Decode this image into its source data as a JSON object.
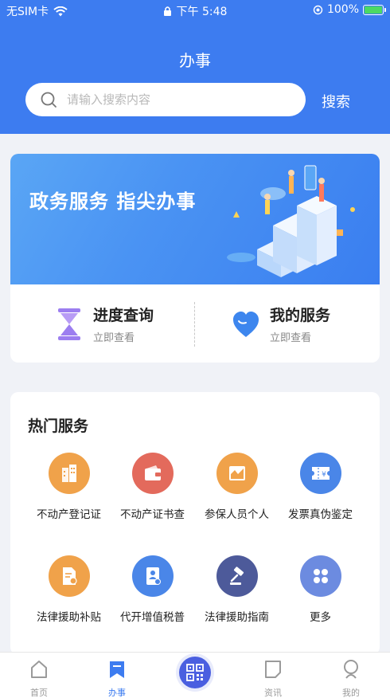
{
  "status_bar": {
    "carrier": "无SIM卡",
    "time": "下午 5:48",
    "battery": "100%"
  },
  "header": {
    "title": "办事",
    "search_placeholder": "请输入搜索内容",
    "search_button": "搜索"
  },
  "banner": {
    "text": "政务服务  指尖办事"
  },
  "quick": [
    {
      "title": "进度查询",
      "subtitle": "立即查看"
    },
    {
      "title": "我的服务",
      "subtitle": "立即查看"
    }
  ],
  "hot_services": {
    "title": "热门服务",
    "items": [
      {
        "label": "不动产登记证",
        "icon": "building-icon",
        "color": "#f0a24a"
      },
      {
        "label": "不动产证书查",
        "icon": "wallet-icon",
        "color": "#e36a5c"
      },
      {
        "label": "参保人员个人",
        "icon": "chart-icon",
        "color": "#f0a24a"
      },
      {
        "label": "发票真伪鉴定",
        "icon": "ticket-icon",
        "color": "#4a86e8"
      },
      {
        "label": "法律援助补贴",
        "icon": "document-icon",
        "color": "#f0a24a"
      },
      {
        "label": "代开增值税普",
        "icon": "id-card-icon",
        "color": "#4a86e8"
      },
      {
        "label": "法律援助指南",
        "icon": "gavel-icon",
        "color": "#4d5a9a"
      },
      {
        "label": "更多",
        "icon": "grid-icon",
        "color": "#6c8be0"
      }
    ]
  },
  "tabbar": {
    "items": [
      {
        "label": "首页",
        "active": false
      },
      {
        "label": "办事",
        "active": true
      },
      {
        "label": "资讯",
        "active": false
      },
      {
        "label": "我的",
        "active": false
      }
    ]
  },
  "colors": {
    "primary": "#3d7cf0",
    "active_tab": "#3d7cf0",
    "scan_button": "#4a5fe0"
  }
}
